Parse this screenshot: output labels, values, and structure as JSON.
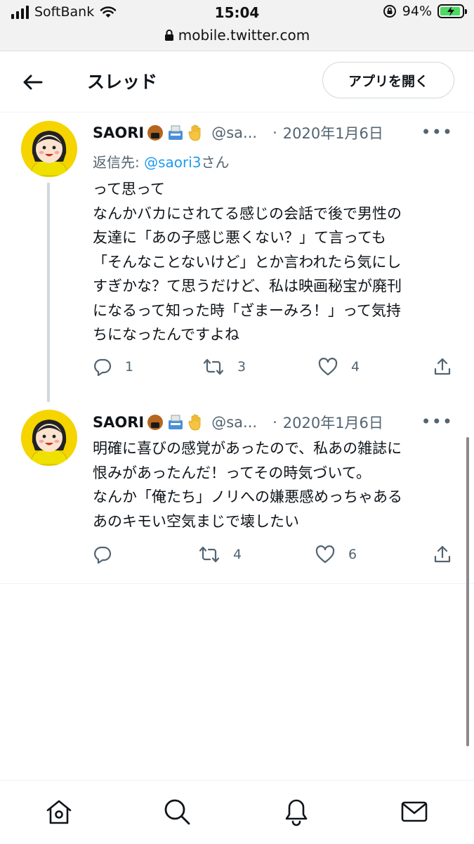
{
  "status_bar": {
    "carrier": "SoftBank",
    "time": "15:04",
    "battery": "94%",
    "battery_level": 0.94,
    "url": "mobile.twitter.com"
  },
  "header": {
    "title": "スレッド",
    "open_app_label": "アプリを開く"
  },
  "tweets": [
    {
      "name": "SAORI",
      "handle": "@sa...",
      "separator": "·",
      "date": "2020年1月6日",
      "more": "•••",
      "reply_to_prefix": "返信先: ",
      "reply_to_mention": "@saori3",
      "reply_to_suffix": "さん",
      "lines": [
        "って思って",
        "なんかバカにされてる感じの会話で後で男性の",
        "友達に「あの子感じ悪くない？」て言っても",
        "「そんなことないけど」とか言われたら気にし",
        "すぎかな？て思うだけど、私は映画秘宝が廃刊",
        "になるって知った時「ざまーみろ！」って気持",
        "ちになったんですよね"
      ],
      "replies": "1",
      "retweets": "3",
      "likes": "4"
    },
    {
      "name": "SAORI",
      "handle": "@sa...",
      "separator": "·",
      "date": "2020年1月6日",
      "more": "•••",
      "lines": [
        "明確に喜びの感覚があったので、私あの雑誌に",
        "恨みがあったんだ！ってその時気づいて。",
        "なんか「俺たち」ノリへの嫌悪感めっちゃある",
        "あのキモい空気まじで壊したい"
      ],
      "replies": "",
      "retweets": "4",
      "likes": "6"
    }
  ],
  "icons": {
    "back": "arrow-left-icon",
    "reply": "speech-bubble-icon",
    "retweet": "retweet-icon",
    "like": "heart-icon",
    "share": "share-icon",
    "home": "home-icon",
    "search": "search-icon",
    "notifications": "bell-icon",
    "messages": "envelope-icon"
  },
  "colors": {
    "link": "#1d9bf0",
    "secondary_text": "#536471",
    "avatar_bg": "#f5d400"
  }
}
